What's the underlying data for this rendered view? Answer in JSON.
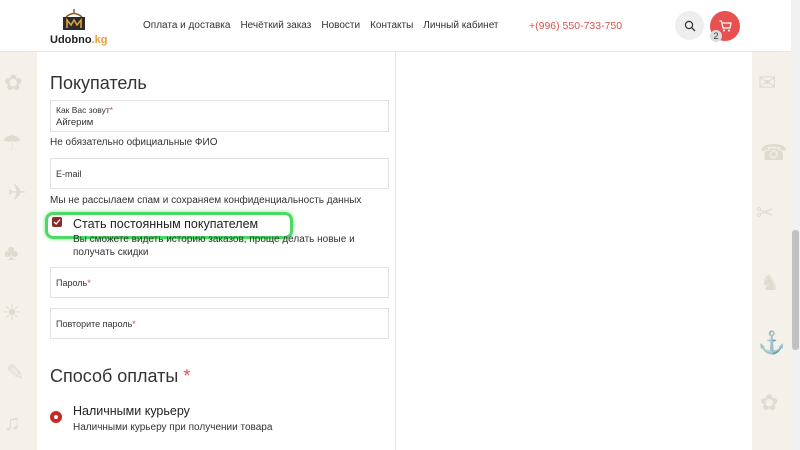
{
  "brand": {
    "name": "Udobno",
    "suffix": ".kg"
  },
  "nav": [
    "Оплата и доставка",
    "Нечёткий заказ",
    "Новости",
    "Контакты",
    "Личный кабинет"
  ],
  "phone": "+(996) 550-733-750",
  "cart": {
    "count": "2"
  },
  "icons": {
    "search": "search-icon",
    "cart": "cart-icon",
    "check": "check-icon"
  },
  "colors": {
    "accent": "#e8514f",
    "phone": "#d9534f",
    "highlight": "#4cd964",
    "checkbox": "#8a2a2a"
  },
  "buyer": {
    "title": "Покупатель",
    "name_field": {
      "label": "Как Вас зовут",
      "required": "*",
      "value": "Айгерим"
    },
    "name_hint": "Не обязательно официальные ФИО",
    "email_field": {
      "placeholder": "E-mail"
    },
    "email_hint": "Мы не рассылаем спам и сохраняем конфиденциальность данных",
    "regular": {
      "label": "Стать постоянным покупателем",
      "checked": true,
      "description": "Вы сможете видеть историю заказов, проще делать новые и получать скидки"
    },
    "password_field": {
      "label": "Пароль",
      "required": "*"
    },
    "repeat_password_field": {
      "label": "Повторите пароль",
      "required": "*"
    }
  },
  "payment": {
    "title": "Способ оплаты",
    "required": "*",
    "option": {
      "label": "Наличными курьеру",
      "description": "Наличными курьеру при получении товара",
      "selected": true
    }
  }
}
